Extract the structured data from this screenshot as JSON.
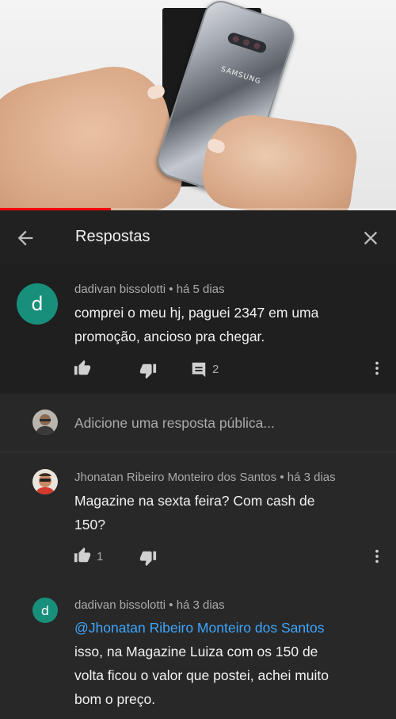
{
  "video": {
    "phone_brand": "SAMSUNG",
    "progress_fraction": 0.28,
    "progress_color": "#ff0000"
  },
  "header": {
    "title": "Respostas",
    "back_icon": "arrow-back-icon",
    "close_icon": "close-icon"
  },
  "parent_comment": {
    "avatar_letter": "d",
    "avatar_color": "#188f7a",
    "author": "dadivan bissolotti",
    "time": "há 5 dias",
    "lines": [
      "comprei o meu hj, paguei 2347 em uma",
      "promoção, ancioso pra chegar."
    ],
    "reply_count": "2"
  },
  "reply_input": {
    "placeholder": "Adicione uma resposta pública..."
  },
  "replies": [
    {
      "author": "Jhonatan Ribeiro Monteiro dos Santos",
      "time": "há 3 dias",
      "lines": [
        "Magazine na sexta feira? Com cash de",
        "150?"
      ],
      "like_count": "1"
    },
    {
      "avatar_letter": "d",
      "author": "dadivan bissolotti",
      "time": "há 3 dias",
      "mention": "@Jhonatan Ribeiro Monteiro dos Santos",
      "lines": [
        "isso, na Magazine Luiza com os 150 de",
        "volta ficou o valor que postei, achei muito",
        "bom o preço."
      ]
    }
  ],
  "separator": "•"
}
